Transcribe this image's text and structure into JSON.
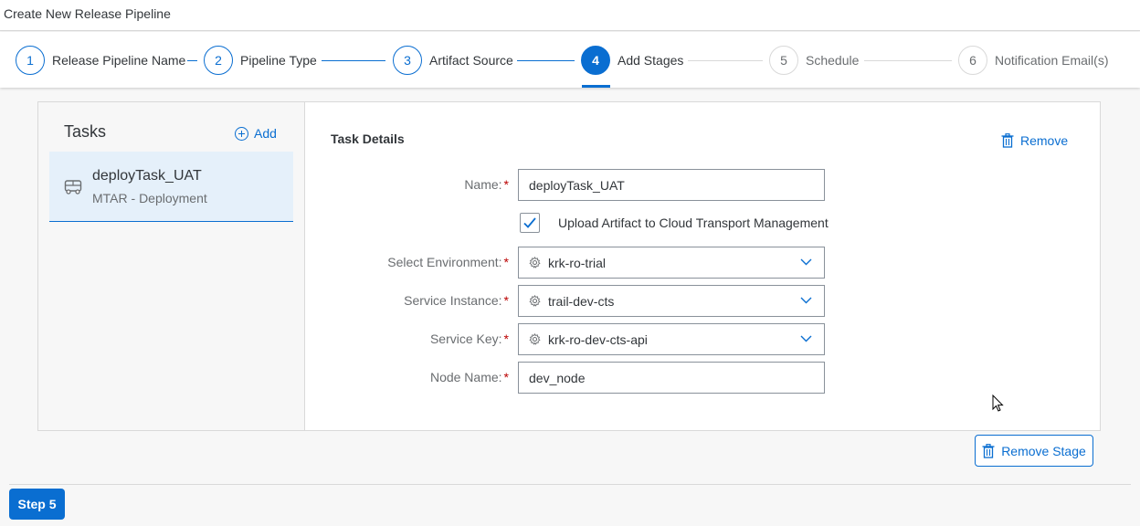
{
  "window": {
    "title": "Create New Release Pipeline"
  },
  "wizard": {
    "steps": [
      {
        "number": "1",
        "label": "Release Pipeline Name",
        "state": "completed"
      },
      {
        "number": "2",
        "label": "Pipeline Type",
        "state": "completed"
      },
      {
        "number": "3",
        "label": "Artifact Source",
        "state": "completed"
      },
      {
        "number": "4",
        "label": "Add Stages",
        "state": "active"
      },
      {
        "number": "5",
        "label": "Schedule",
        "state": "future"
      },
      {
        "number": "6",
        "label": "Notification Email(s)",
        "state": "future"
      }
    ]
  },
  "tasks": {
    "header": "Tasks",
    "add_label": "Add",
    "items": [
      {
        "name": "deployTask_UAT",
        "type": "MTAR - Deployment",
        "icon": "bus-icon"
      }
    ]
  },
  "details": {
    "title": "Task Details",
    "remove_label": "Remove",
    "fields": {
      "name": {
        "label": "Name:",
        "value": "deployTask_UAT"
      },
      "upload": {
        "label": "Upload Artifact to Cloud Transport Management",
        "checked": true
      },
      "environment": {
        "label": "Select Environment:",
        "value": "krk-ro-trial"
      },
      "service_instance": {
        "label": "Service Instance:",
        "value": "trail-dev-cts"
      },
      "service_key": {
        "label": "Service Key:",
        "value": "krk-ro-dev-cts-api"
      },
      "node_name": {
        "label": "Node Name:",
        "value": "dev_node"
      }
    },
    "required_mark": "*"
  },
  "actions": {
    "remove_stage": "Remove Stage",
    "next_step": "Step 5"
  },
  "colors": {
    "accent": "#0a6ed1",
    "required": "#bb0000",
    "selected_bg": "#e5f0fa"
  }
}
